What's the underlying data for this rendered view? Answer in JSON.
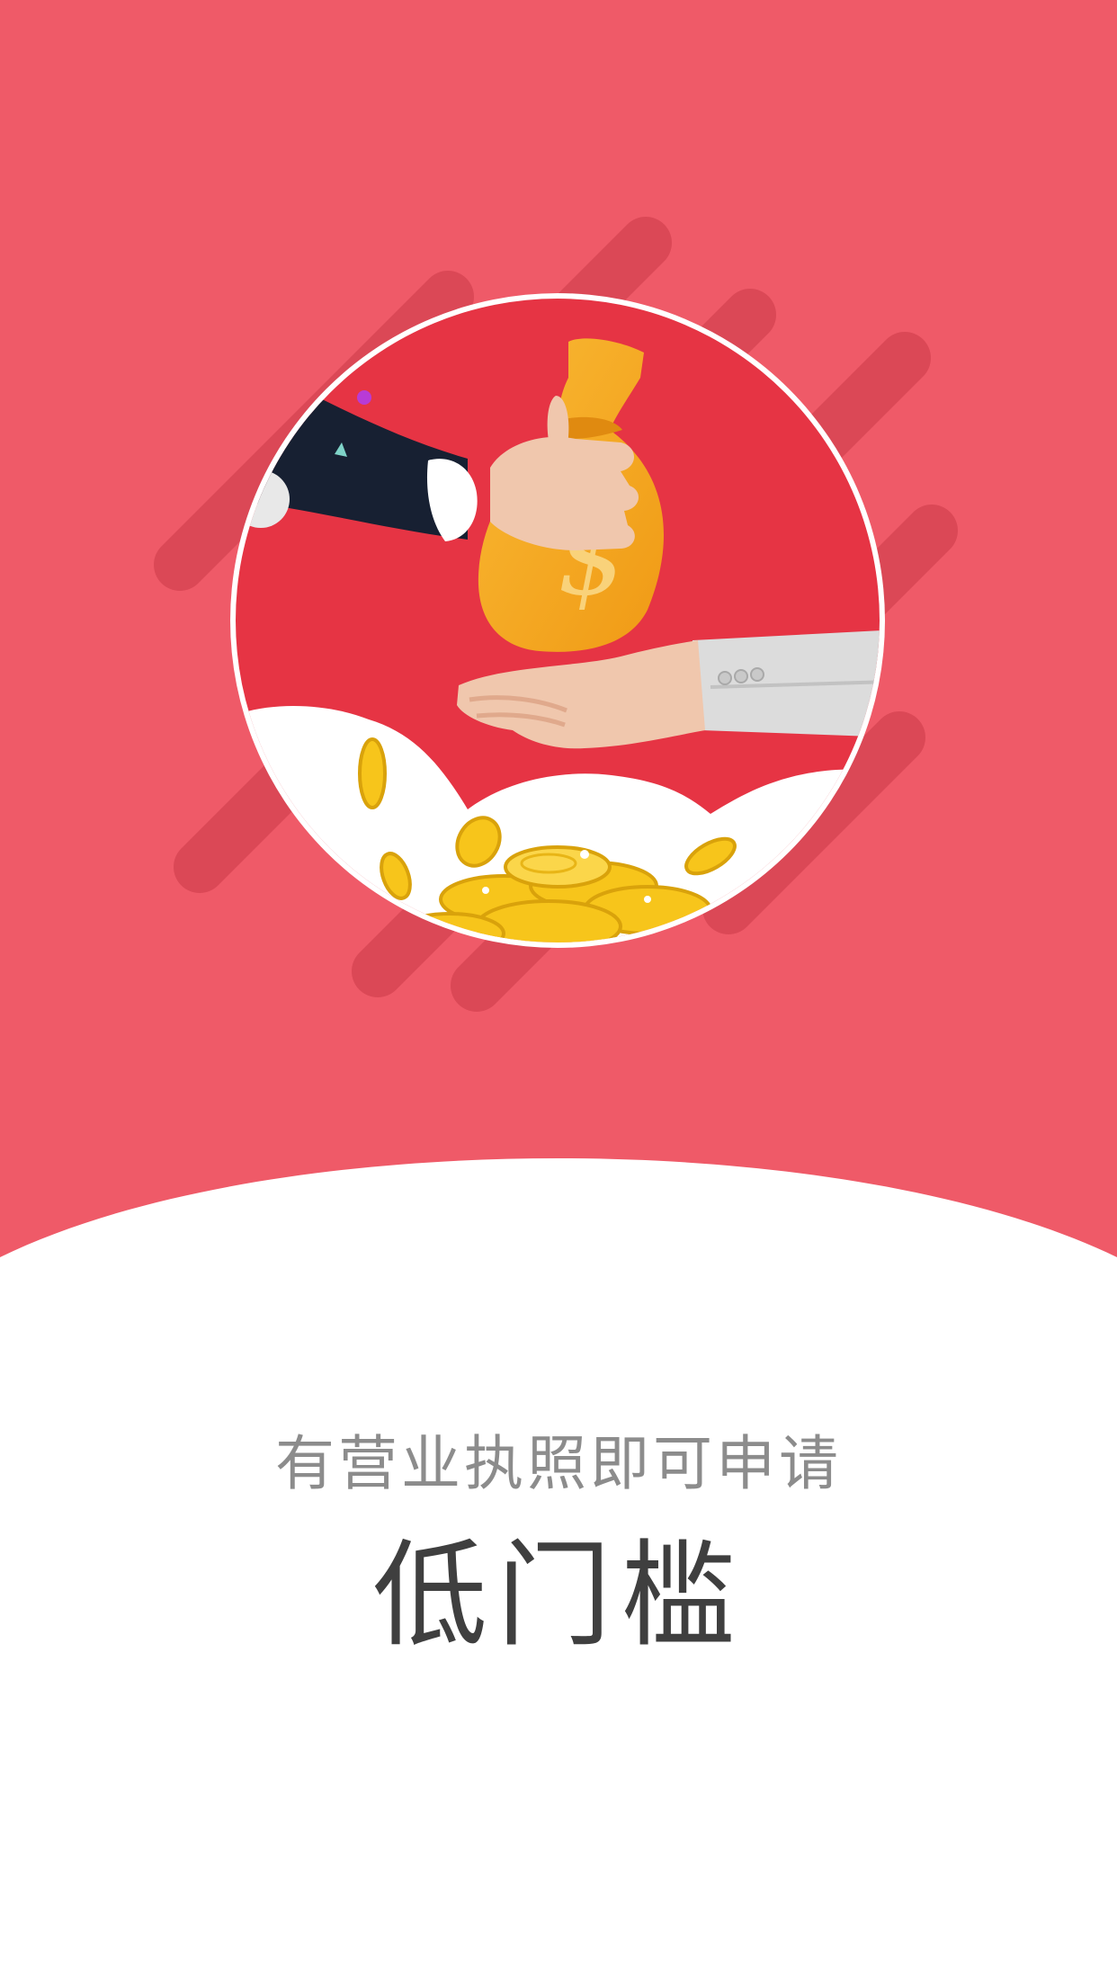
{
  "screen": {
    "subtitle": "有营业执照即可申请",
    "headline": "低门槛"
  },
  "illustration": {
    "icons": [
      "money-bag-icon",
      "dollar-sign-icon",
      "gold-coin-icon",
      "hand-icon"
    ]
  },
  "colors": {
    "hero_background": "#ef5a68",
    "stripe": "#db4856",
    "circle_background": "#e63444",
    "circle_border": "#ffffff",
    "money_bag": "#f6a623",
    "coin": "#f7c51b",
    "sleeve_dark": "#172032",
    "sleeve_light": "#dcdcdc",
    "skin": "#f0c7ad",
    "subtitle_text": "#8c8c8c",
    "headline_text": "#3f3f3f"
  }
}
